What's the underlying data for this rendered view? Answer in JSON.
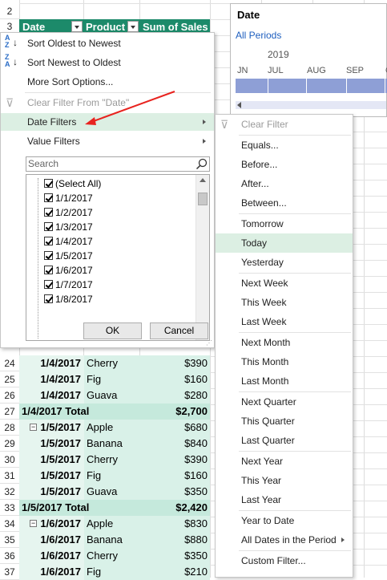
{
  "pivot": {
    "headers": {
      "date": "Date",
      "product": "Product",
      "sales": "Sum of Sales"
    },
    "rows": [
      {
        "num": "24",
        "date": "1/4/2017",
        "product": "Cherry",
        "sales": "$390",
        "type": "item"
      },
      {
        "num": "25",
        "date": "1/4/2017",
        "product": "Fig",
        "sales": "$160",
        "type": "item"
      },
      {
        "num": "26",
        "date": "1/4/2017",
        "product": "Guava",
        "sales": "$280",
        "type": "item"
      },
      {
        "num": "27",
        "date": "1/4/2017 Total",
        "product": "",
        "sales": "$2,700",
        "type": "total"
      },
      {
        "num": "28",
        "date": "1/5/2017",
        "product": "Apple",
        "sales": "$680",
        "type": "item"
      },
      {
        "num": "29",
        "date": "1/5/2017",
        "product": "Banana",
        "sales": "$840",
        "type": "item"
      },
      {
        "num": "30",
        "date": "1/5/2017",
        "product": "Cherry",
        "sales": "$390",
        "type": "item"
      },
      {
        "num": "31",
        "date": "1/5/2017",
        "product": "Fig",
        "sales": "$160",
        "type": "item"
      },
      {
        "num": "32",
        "date": "1/5/2017",
        "product": "Guava",
        "sales": "$350",
        "type": "item"
      },
      {
        "num": "33",
        "date": "1/5/2017 Total",
        "product": "",
        "sales": "$2,420",
        "type": "total"
      },
      {
        "num": "34",
        "date": "1/6/2017",
        "product": "Apple",
        "sales": "$830",
        "type": "item"
      },
      {
        "num": "35",
        "date": "1/6/2017",
        "product": "Banana",
        "sales": "$880",
        "type": "item"
      },
      {
        "num": "36",
        "date": "1/6/2017",
        "product": "Cherry",
        "sales": "$350",
        "type": "item"
      },
      {
        "num": "37",
        "date": "1/6/2017",
        "product": "Fig",
        "sales": "$210",
        "type": "item"
      }
    ],
    "top_rows": [
      "2",
      "3"
    ]
  },
  "filter_menu": {
    "sort_oldest": "Sort Oldest to Newest",
    "sort_newest": "Sort Newest to Oldest",
    "more_sort": "More Sort Options...",
    "clear_filter": "Clear Filter From \"Date\"",
    "date_filters": "Date Filters",
    "value_filters": "Value Filters",
    "search_placeholder": "Search",
    "list": [
      "(Select All)",
      "1/1/2017",
      "1/2/2017",
      "1/3/2017",
      "1/4/2017",
      "1/5/2017",
      "1/6/2017",
      "1/7/2017",
      "1/8/2017"
    ],
    "ok": "OK",
    "cancel": "Cancel"
  },
  "date_submenu": [
    {
      "label": "Clear Filter",
      "disabled": true
    },
    {
      "label": "Equals...",
      "sep_before": true
    },
    {
      "label": "Before..."
    },
    {
      "label": "After..."
    },
    {
      "label": "Between..."
    },
    {
      "label": "Tomorrow",
      "sep_before": true
    },
    {
      "label": "Today",
      "selected": true
    },
    {
      "label": "Yesterday"
    },
    {
      "label": "Next Week",
      "sep_before": true
    },
    {
      "label": "This Week"
    },
    {
      "label": "Last Week"
    },
    {
      "label": "Next Month",
      "sep_before": true
    },
    {
      "label": "This Month"
    },
    {
      "label": "Last Month"
    },
    {
      "label": "Next Quarter",
      "sep_before": true
    },
    {
      "label": "This Quarter"
    },
    {
      "label": "Last Quarter"
    },
    {
      "label": "Next Year",
      "sep_before": true
    },
    {
      "label": "This Year"
    },
    {
      "label": "Last Year"
    },
    {
      "label": "Year to Date",
      "sep_before": true
    },
    {
      "label": "All Dates in the Period",
      "submenu": true
    },
    {
      "label": "Custom Filter...",
      "sep_before": true
    }
  ],
  "timeline": {
    "title": "Date",
    "period": "All Periods",
    "year": "2019",
    "months": [
      "JN",
      "JUL",
      "AUG",
      "SEP",
      "O"
    ]
  },
  "colors": {
    "header": "#1c8a6a",
    "total": "#c5e9dc",
    "item": "#d9f1e8",
    "timeline_bar": "#8e9fd6",
    "arrow": "#e8231f"
  }
}
